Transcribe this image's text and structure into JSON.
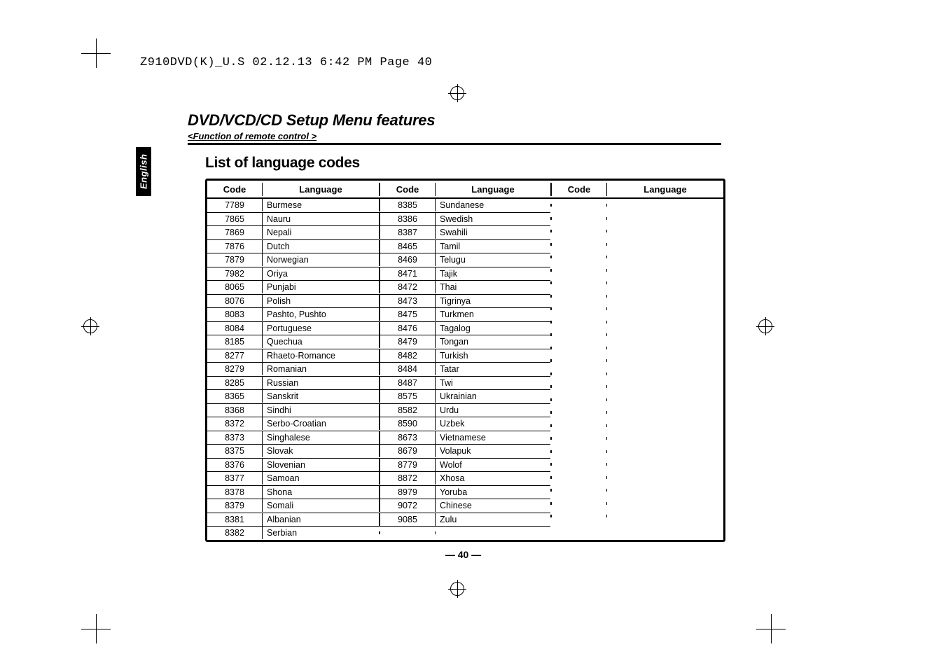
{
  "print_header": "Z910DVD(K)_U.S  02.12.13  6:42 PM  Page 40",
  "side_label": "English",
  "title_main": "DVD/VCD/CD Setup Menu features",
  "subtitle": "<Function of remote control >",
  "section_heading": "List of language codes",
  "col_headers": {
    "code": "Code",
    "language": "Language"
  },
  "columns": [
    [
      {
        "code": "7789",
        "lang": "Burmese"
      },
      {
        "code": "7865",
        "lang": "Nauru"
      },
      {
        "code": "7869",
        "lang": "Nepali"
      },
      {
        "code": "7876",
        "lang": "Dutch"
      },
      {
        "code": "7879",
        "lang": "Norwegian"
      },
      {
        "code": "7982",
        "lang": "Oriya"
      },
      {
        "code": "8065",
        "lang": "Punjabi"
      },
      {
        "code": "8076",
        "lang": "Polish"
      },
      {
        "code": "8083",
        "lang": "Pashto, Pushto"
      },
      {
        "code": "8084",
        "lang": "Portuguese"
      },
      {
        "code": "8185",
        "lang": "Quechua"
      },
      {
        "code": "8277",
        "lang": "Rhaeto-Romance"
      },
      {
        "code": "8279",
        "lang": "Romanian"
      },
      {
        "code": "8285",
        "lang": "Russian"
      },
      {
        "code": "8365",
        "lang": "Sanskrit"
      },
      {
        "code": "8368",
        "lang": "Sindhi"
      },
      {
        "code": "8372",
        "lang": "Serbo-Croatian"
      },
      {
        "code": "8373",
        "lang": "Singhalese"
      },
      {
        "code": "8375",
        "lang": "Slovak"
      },
      {
        "code": "8376",
        "lang": "Slovenian"
      },
      {
        "code": "8377",
        "lang": "Samoan"
      },
      {
        "code": "8378",
        "lang": "Shona"
      },
      {
        "code": "8379",
        "lang": "Somali"
      },
      {
        "code": "8381",
        "lang": "Albanian"
      },
      {
        "code": "8382",
        "lang": "Serbian"
      }
    ],
    [
      {
        "code": "8385",
        "lang": "Sundanese"
      },
      {
        "code": "8386",
        "lang": "Swedish"
      },
      {
        "code": "8387",
        "lang": "Swahili"
      },
      {
        "code": "8465",
        "lang": "Tamil"
      },
      {
        "code": "8469",
        "lang": "Telugu"
      },
      {
        "code": "8471",
        "lang": "Tajik"
      },
      {
        "code": "8472",
        "lang": "Thai"
      },
      {
        "code": "8473",
        "lang": "Tigrinya"
      },
      {
        "code": "8475",
        "lang": "Turkmen"
      },
      {
        "code": "8476",
        "lang": "Tagalog"
      },
      {
        "code": "8479",
        "lang": "Tongan"
      },
      {
        "code": "8482",
        "lang": "Turkish"
      },
      {
        "code": "8484",
        "lang": "Tatar"
      },
      {
        "code": "8487",
        "lang": "Twi"
      },
      {
        "code": "8575",
        "lang": "Ukrainian"
      },
      {
        "code": "8582",
        "lang": "Urdu"
      },
      {
        "code": "8590",
        "lang": "Uzbek"
      },
      {
        "code": "8673",
        "lang": "Vietnamese"
      },
      {
        "code": "8679",
        "lang": "Volapuk"
      },
      {
        "code": "8779",
        "lang": "Wolof"
      },
      {
        "code": "8872",
        "lang": "Xhosa"
      },
      {
        "code": "8979",
        "lang": "Yoruba"
      },
      {
        "code": "9072",
        "lang": "Chinese"
      },
      {
        "code": "9085",
        "lang": "Zulu"
      }
    ],
    []
  ],
  "page_number": "— 40 —"
}
